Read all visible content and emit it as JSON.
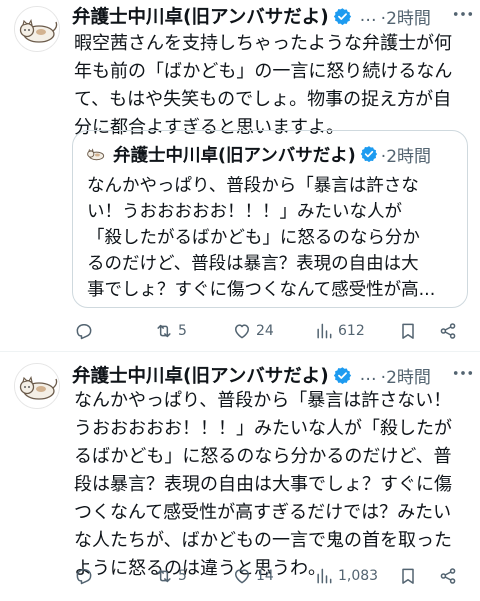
{
  "tweets": [
    {
      "author": {
        "name": "弁護士中川卓(旧アンバサだよ)",
        "verified": true,
        "avatar": "cat-avatar"
      },
      "separator": "…",
      "time": "·2時間",
      "text_lines": [
        "暇空茜さんを支持しちゃったような弁護士が何",
        "年も前の「ばかども」の一言に怒り続けるなん",
        "て、もはや失笑ものでしょ。物事の捉え方が自",
        "分に都合よすぎると思いますよ。"
      ],
      "quote": {
        "author": {
          "name": "弁護士中川卓(旧アンバサだよ)",
          "verified": true,
          "avatar": "cat-avatar"
        },
        "time": "·2時間",
        "text_lines": [
          "なんかやっぱり、普段から「暴言は許さな",
          "い！うおおおおお！！！」みたいな人が",
          "「殺したがるばかども」に怒るのなら分か",
          "るのだけど、普段は暴言？表現の自由は大",
          "事でしょ？すぐに傷つくなんて感受性が高..."
        ]
      },
      "actions": {
        "reply_count": "",
        "retweet_count": "5",
        "like_count": "24",
        "views_count": "612"
      }
    },
    {
      "author": {
        "name": "弁護士中川卓(旧アンバサだよ)",
        "verified": true,
        "avatar": "cat-avatar"
      },
      "separator": "…",
      "time": "·2時間",
      "text_lines": [
        "なんかやっぱり、普段から「暴言は許さない！",
        "うおおおおお！！！」みたいな人が「殺したが",
        "るばかども」に怒るのなら分かるのだけど、普",
        "段は暴言？表現の自由は大事でしょ？すぐに傷",
        "つくなんて感受性が高すぎるだけでは？みたい",
        "な人たちが、ばかどもの一言で鬼の首を取った",
        "ように怒るのは違うと思うわ。"
      ],
      "actions": {
        "reply_count": "",
        "retweet_count": "5",
        "like_count": "14",
        "views_count": "1,083"
      }
    }
  ],
  "colors": {
    "text": "#0f1419",
    "secondary": "#536471",
    "verified": "#1d9bf0",
    "divider": "#eff3f4",
    "quote_border": "#cfd9de"
  },
  "icons": [
    "more-icon",
    "verified-icon",
    "reply-icon",
    "retweet-icon",
    "like-icon",
    "views-icon",
    "bookmark-icon",
    "share-icon"
  ]
}
